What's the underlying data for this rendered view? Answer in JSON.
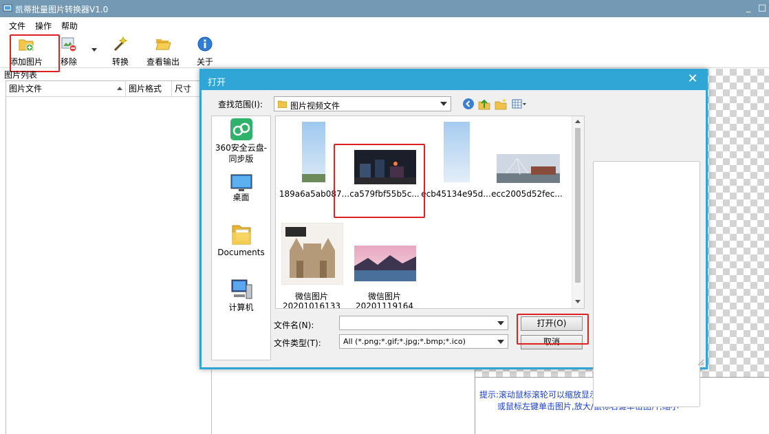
{
  "window": {
    "title": "凯蒂批量图片转换器V1.0",
    "minimize": "_",
    "maximize": "□"
  },
  "menu": [
    "文件",
    "操作",
    "帮助"
  ],
  "toolbar": {
    "add_label": "添加图片",
    "remove_label": "移除",
    "convert_label": "转换",
    "view_output_label": "查看输出",
    "about_label": "关于"
  },
  "list": {
    "title": "图片列表",
    "columns": [
      "图片文件",
      "图片格式",
      "尺寸"
    ]
  },
  "preview_hint": {
    "line1": "提示:滚动鼠标滚轮可以缩放显示图片",
    "line2": "或鼠标左键单击图片,放大/鼠标右键单击图片,缩小"
  },
  "dialog": {
    "title": "打开",
    "close": "✕",
    "look_in_label": "查找范围(I):",
    "look_in_value": "图片视频文件",
    "places": [
      {
        "label": "360安全云盘-同步版",
        "icon": "cloud-sync-icon"
      },
      {
        "label": "桌面",
        "icon": "desktop-icon"
      },
      {
        "label": "Documents",
        "icon": "documents-folder-icon"
      },
      {
        "label": "计算机",
        "icon": "computer-icon"
      }
    ],
    "files": [
      {
        "name": "189a6a5ab087..."
      },
      {
        "name": "ca579fbf55b5c..."
      },
      {
        "name": "ecb45134e95d..."
      },
      {
        "name": "ecc2005d52fec..."
      },
      {
        "name": "微信图片",
        "name2": "20201016133"
      },
      {
        "name": "微信图片",
        "name2": "20201119164"
      }
    ],
    "filename_label": "文件名(N):",
    "filename_value": "",
    "filetype_label": "文件类型(T):",
    "filetype_value": "All (*.png;*.gif;*.jpg;*.bmp;*.ico)",
    "open_button": "打开(O)",
    "cancel_button": "取消"
  },
  "colors": {
    "titlebar": "#7399b4",
    "dialog_frame": "#2fa6d6",
    "highlight": "#e02020",
    "hint_text": "#1a3fd4"
  }
}
